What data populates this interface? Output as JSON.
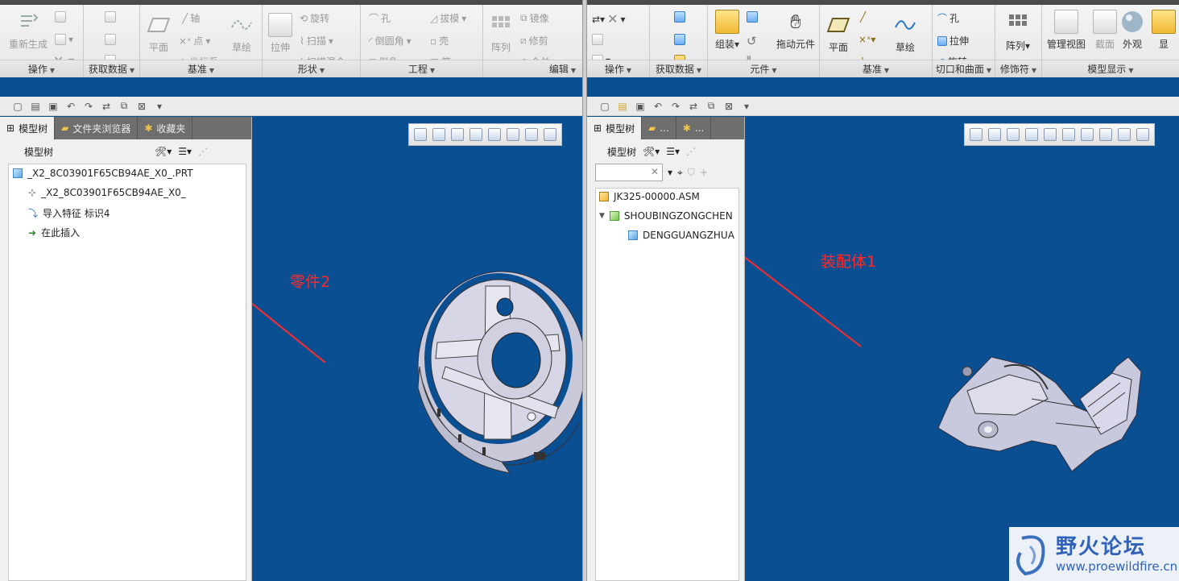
{
  "left": {
    "ribbon": {
      "groups": [
        {
          "title": "操作"
        },
        {
          "title": "获取数据"
        },
        {
          "title": "基准"
        },
        {
          "title": "形状"
        },
        {
          "title": "工程"
        },
        {
          "title": "编辑"
        }
      ],
      "buttons": {
        "regenerate": "重新生成",
        "plane": "平面",
        "axis": "轴",
        "point": "点",
        "csys": "坐标系",
        "sketch": "草绘",
        "extrude": "拉伸",
        "revolve": "旋转",
        "sweep": "扫描",
        "swept_blend": "扫描混合",
        "hole": "孔",
        "round": "倒圆角",
        "chamfer": "倒角",
        "draft": "拔模",
        "shell": "壳",
        "rib": "筋",
        "pattern": "阵列",
        "mirror": "镜像",
        "trim": "修剪",
        "merge": "合并"
      }
    },
    "tabs": [
      "模型树",
      "文件夹浏览器",
      "收藏夹"
    ],
    "tree_header": "模型树",
    "tree_nodes": [
      "_X2_8C03901F65CB94AE_X0_.PRT",
      "_X2_8C03901F65CB94AE_X0_",
      "导入特征 标识4",
      "在此插入"
    ],
    "annotation": "零件2"
  },
  "right": {
    "ribbon": {
      "groups": [
        {
          "title": "操作"
        },
        {
          "title": "获取数据"
        },
        {
          "title": "元件"
        },
        {
          "title": "基准"
        },
        {
          "title": "切口和曲面"
        },
        {
          "title": "修饰符"
        },
        {
          "title": "模型显示"
        }
      ],
      "buttons": {
        "assemble": "组装",
        "drag": "拖动元件",
        "plane": "平面",
        "sketch": "草绘",
        "hole": "孔",
        "extrude": "拉伸",
        "revolve": "旋转",
        "pattern": "阵列",
        "manage_views": "管理视图",
        "section": "截面",
        "appearance": "外观",
        "display": "显"
      }
    },
    "tabs": [
      "模型树",
      "...",
      "..."
    ],
    "tree_header": "模型树",
    "tree_nodes": [
      "JK325-00000.ASM",
      "SHOUBINGZONGCHEN",
      "DENGGUANGZHUA"
    ],
    "annotation": "装配体1"
  },
  "watermark": {
    "title": "野火论坛",
    "url": "www.proewildfire.cn"
  }
}
